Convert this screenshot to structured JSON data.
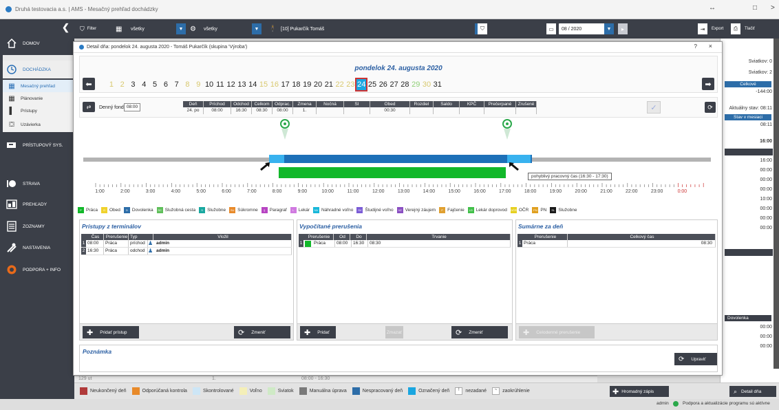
{
  "window": {
    "title": "Druhá testovacia a.s. | AMS - Mesačný prehľad dochádzky",
    "controls": [
      "↔",
      "□",
      ">"
    ]
  },
  "sidebar": {
    "items": [
      {
        "label": "Domov",
        "icon": "home-icon"
      },
      {
        "label": "Dochádzka",
        "icon": "clock-icon"
      },
      {
        "label": "Prístupový sys.",
        "icon": "card-icon"
      },
      {
        "label": "Strava",
        "icon": "food-icon"
      },
      {
        "label": "Prehľady",
        "icon": "report-icon"
      },
      {
        "label": "Zoznamy",
        "icon": "list-icon"
      },
      {
        "label": "Nastavenia",
        "icon": "tools-icon"
      },
      {
        "label": "Podpora + info",
        "icon": "lifebuoy-icon"
      }
    ],
    "subitems": [
      {
        "label": "Mesačný prehľad",
        "icon": "month-icon"
      },
      {
        "label": "Plánovanie",
        "icon": "calendar-icon"
      },
      {
        "label": "Prístupy",
        "icon": "door-icon"
      },
      {
        "label": "Uzávierka",
        "icon": "lock-icon"
      }
    ]
  },
  "toolbar": {
    "filter_label": "Filter",
    "dept_value": "všetky",
    "group_value": "všetky",
    "employee_value": "[10] Pukarčík Tomáš",
    "month_value": "08 / 2020",
    "export_label": "Export",
    "print_label": "Tlačiť"
  },
  "rightpanel": {
    "lines": [
      "Sviatkov:",
      "Sviatkov:",
      "Celkové",
      "-144:00",
      "Aktuálny stav: 08:11",
      "Stav v mesiaci",
      "08:11",
      "16:00",
      "16:00",
      "00:00",
      "00:00",
      "00:00",
      "10:00",
      "00:00",
      "00:00",
      "00:00",
      "Dovolenka",
      "00:00",
      "00:00",
      "00:00"
    ],
    "hidden_labels": [
      "Sviatkov: 0",
      "Sviatkov: 2"
    ]
  },
  "modal": {
    "title": "Detail dňa: pondelok 24. augusta 2020 - Tomáš Pukarčík (skupina 'Výroba')",
    "help": "?",
    "close": "×",
    "date_title": "pondelok 24. augusta 2020",
    "days": [
      "1",
      "2",
      "3",
      "4",
      "5",
      "6",
      "7",
      "8",
      "9",
      "10",
      "11",
      "12",
      "13",
      "14",
      "15",
      "16",
      "17",
      "18",
      "19",
      "20",
      "21",
      "22",
      "23",
      "24",
      "25",
      "26",
      "27",
      "28",
      "29",
      "30",
      "31"
    ],
    "weekend_days": [
      "1",
      "2",
      "8",
      "9",
      "15",
      "16",
      "22",
      "23",
      "29",
      "30"
    ],
    "holiday_days": [
      "29"
    ],
    "selected_day": "24",
    "fund_label": "Denný fond:",
    "fund_value": "08:00",
    "summary_headers": [
      "Deň",
      "Príchod",
      "Odchod",
      "Celkom",
      "Odprac.",
      "Zmena",
      "Nočná",
      "SI",
      "Obed",
      "Rozdiel",
      "Saldo",
      "KPČ",
      "Prečerpané",
      "Zrušené"
    ],
    "summary_values": [
      "24. po",
      "08:00",
      "16:30",
      "08:30",
      "08:00",
      "1.",
      "",
      "",
      "00:30",
      "",
      "",
      "",
      "",
      ""
    ],
    "timeline": {
      "hours": [
        "1:00",
        "2:00",
        "3:00",
        "4:00",
        "5:00",
        "6:00",
        "7:00",
        "8:00",
        "9:00",
        "10:00",
        "11:00",
        "12:00",
        "13:00",
        "14:00",
        "15:00",
        "16:00",
        "17:00",
        "18:00",
        "19:00",
        "20:00",
        "21:00",
        "22:00",
        "23:00",
        "0:00"
      ],
      "tooltip": "pohyblivý pracovný čas (16:30 - 17:30)"
    },
    "legend": [
      {
        "label": "Práca",
        "color": "#12b82a",
        "code": "P"
      },
      {
        "label": "Obed",
        "color": "#f0d22c",
        "code": "O"
      },
      {
        "label": "Dovolenka",
        "color": "#2d6da8",
        "code": "D"
      },
      {
        "label": "Služobná cesta",
        "color": "#5fbf5a",
        "code": "SC"
      },
      {
        "label": "Služobne",
        "color": "#19a8a0",
        "code": "S"
      },
      {
        "label": "Súkromne",
        "color": "#e88a2a",
        "code": "SU"
      },
      {
        "label": "Paragraf",
        "color": "#b744c2",
        "code": "§"
      },
      {
        "label": "Lekár",
        "color": "#d07ae0",
        "code": "L"
      },
      {
        "label": "Náhradné voľno",
        "color": "#18b7d9",
        "code": "NV"
      },
      {
        "label": "Študijné voľno",
        "color": "#7b5cd6",
        "code": "SV"
      },
      {
        "label": "Verejný záujem",
        "color": "#8a4fc2",
        "code": "VZ"
      },
      {
        "label": "Fajčenie",
        "color": "#e0a030",
        "code": "F"
      },
      {
        "label": "Lekár doprovod",
        "color": "#42c04a",
        "code": "LD"
      },
      {
        "label": "OČR",
        "color": "#e6d020",
        "code": "OČR"
      },
      {
        "label": "PN",
        "color": "#e0a020",
        "code": "PN"
      },
      {
        "label": "Služobne",
        "color": "#1a1a1a",
        "code": "SL"
      }
    ],
    "panel_terminals": {
      "title": "Prístupy z terminálov",
      "headers": [
        "Čas",
        "Prerušenie",
        "Typ",
        "Vložil"
      ],
      "rows": [
        {
          "idx": "1",
          "time": "08:00",
          "type": "Práca",
          "dir": "príchod",
          "user": "admin"
        },
        {
          "idx": "2",
          "time": "16:30",
          "type": "Práca",
          "dir": "odchod",
          "user": "admin"
        }
      ],
      "add_label": "Pridať prístup",
      "change_label": "Zmeniť"
    },
    "panel_breaks": {
      "title": "Vypočítané prerušenia",
      "headers": [
        "Prerušenie",
        "Od",
        "Do",
        "Trvanie"
      ],
      "rows": [
        {
          "idx": "1",
          "type": "Práca",
          "from": "08:00",
          "to": "16:30",
          "dur": "08:30"
        }
      ],
      "add_label": "Pridať",
      "delete_label": "Zmazať",
      "change_label": "Zmeniť"
    },
    "panel_summary": {
      "title": "Sumárne za deň",
      "headers": [
        "Prerušenie",
        "Celkový čas"
      ],
      "rows": [
        {
          "idx": "1",
          "type": "Práca",
          "total": "08:30"
        }
      ],
      "add_label": "Celodenné prerušenie"
    },
    "notes_title": "Poznámka",
    "edit_label": "Upraviť"
  },
  "lower_row": {
    "cells": [
      "129 ut",
      "1.",
      "08:00 - 16:30"
    ]
  },
  "statusbar": {
    "legend": [
      {
        "label": "Neukončený deň",
        "color": "#b03a3a"
      },
      {
        "label": "Odporúčaná kontrola",
        "color": "#e88a2a"
      },
      {
        "label": "Skontrolované",
        "color": "#cde6f6"
      },
      {
        "label": "Voľno",
        "color": "#f4efb8"
      },
      {
        "label": "Sviatok",
        "color": "#cfeac6"
      },
      {
        "label": "Manuálna úprava",
        "color": "#7a7a7a"
      },
      {
        "label": "Nespracovaný deň",
        "color": "#2d6da8"
      },
      {
        "label": "Označený deň",
        "color": "#1aa6e0"
      }
    ],
    "unused_label": "nezadané",
    "rounded_label": "zaokrúhlenie",
    "bulk_label": "Hromadný zápis",
    "day_detail_label": "Detail dňa"
  },
  "footer": {
    "user": "admin",
    "status": "Podpora a aktualizácie programu sú aktívne"
  }
}
